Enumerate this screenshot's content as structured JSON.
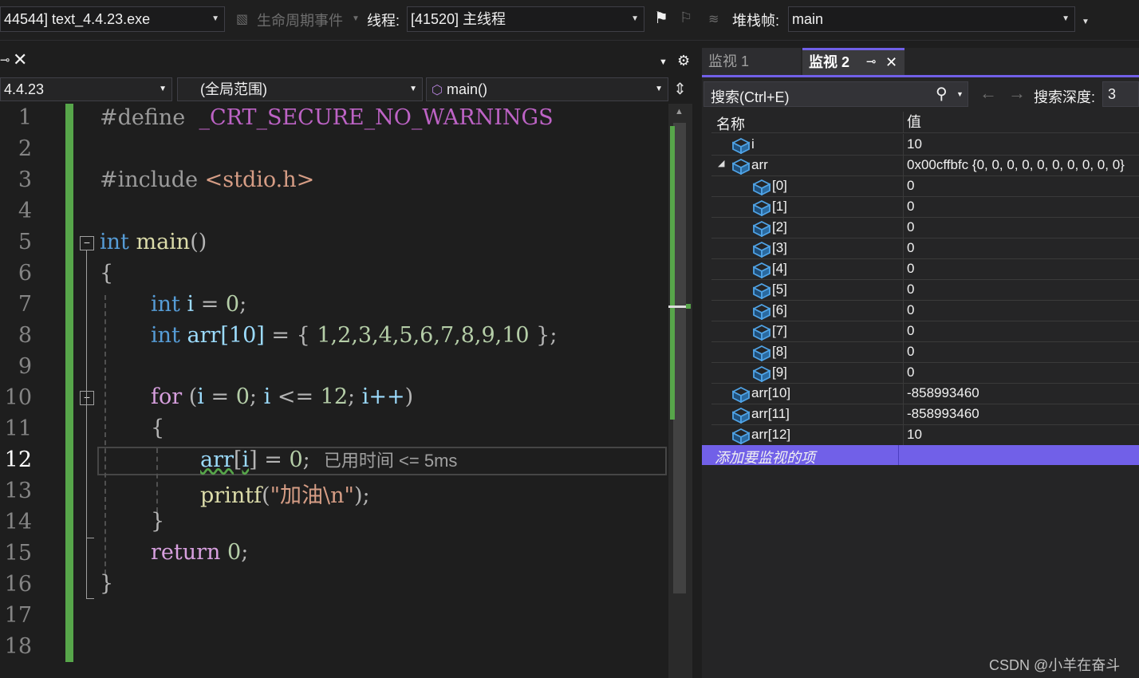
{
  "toolbar": {
    "process": "44544] text_4.4.23.exe",
    "lifecycle": "生命周期事件",
    "thread_label": "线程:",
    "thread_value": "[41520] 主线程",
    "stack_label": "堆栈帧:",
    "stack_value": "main"
  },
  "nav": {
    "project": "4.4.23",
    "scope": "(全局范围)",
    "function": "main()"
  },
  "code": {
    "line_numbers": [
      "1",
      "2",
      "3",
      "4",
      "5",
      "6",
      "7",
      "8",
      "9",
      "10",
      "11",
      "12",
      "13",
      "14",
      "15",
      "16",
      "17",
      "18"
    ],
    "current_line": 12,
    "define_kw": "#define",
    "define_name": "_CRT_SECURE_NO_WARNINGS",
    "include_kw": "#include",
    "include_file": "<stdio.h>",
    "int_kw": "int",
    "main_fn": "main",
    "parens": "()",
    "open_brace": "{",
    "close_brace": "}",
    "i_decl_var": "i",
    "i_decl_rest": " = ",
    "zero": "0",
    "semi": ";",
    "arr_decl": "arr[10]",
    "arr_init_open": " = { ",
    "arr_values": "1,2,3,4,5,6,7,8,9,10",
    "arr_init_close": " };",
    "for_kw": "for",
    "for_open": " (",
    "for_i": "i",
    "for_eq": " = ",
    "for_zero": "0",
    "for_semi1": "; ",
    "for_i2": "i",
    "for_le": " <= ",
    "for_12": "12",
    "for_semi2": "; ",
    "for_inc": "i++",
    "for_close": ")",
    "assign_arr": "arr",
    "assign_lb": "[",
    "assign_i": "i",
    "assign_rb": "]",
    "assign_eq": " = ",
    "assign_zero": "0",
    "assign_semi": ";",
    "elapsed_hint": "已用时间 <= 5ms",
    "printf_fn": "printf",
    "printf_open": "(",
    "printf_str": "\"加油\\n\"",
    "printf_close": ");",
    "return_kw": "return",
    "return_val": " 0",
    "return_semi": ";"
  },
  "watch": {
    "tab1": "监视 1",
    "tab2": "监视 2",
    "search_placeholder": "搜索(Ctrl+E)",
    "depth_label": "搜索深度:",
    "depth_value": "3",
    "col_name": "名称",
    "col_value": "值",
    "rows": [
      {
        "name": "i",
        "value": "10"
      },
      {
        "name": "arr",
        "value": "0x00cffbfc {0, 0, 0, 0, 0, 0, 0, 0, 0, 0}"
      },
      {
        "name": "[0]",
        "value": "0"
      },
      {
        "name": "[1]",
        "value": "0"
      },
      {
        "name": "[2]",
        "value": "0"
      },
      {
        "name": "[3]",
        "value": "0"
      },
      {
        "name": "[4]",
        "value": "0"
      },
      {
        "name": "[5]",
        "value": "0"
      },
      {
        "name": "[6]",
        "value": "0"
      },
      {
        "name": "[7]",
        "value": "0"
      },
      {
        "name": "[8]",
        "value": "0"
      },
      {
        "name": "[9]",
        "value": "0"
      },
      {
        "name": "arr[10]",
        "value": "-858993460"
      },
      {
        "name": "arr[11]",
        "value": "-858993460"
      },
      {
        "name": "arr[12]",
        "value": "10"
      }
    ],
    "add_item": "添加要监视的项"
  },
  "watermark": "CSDN @小羊在奋斗",
  "colors": {
    "accent": "#7160e8",
    "change_bar": "#57a64a"
  }
}
